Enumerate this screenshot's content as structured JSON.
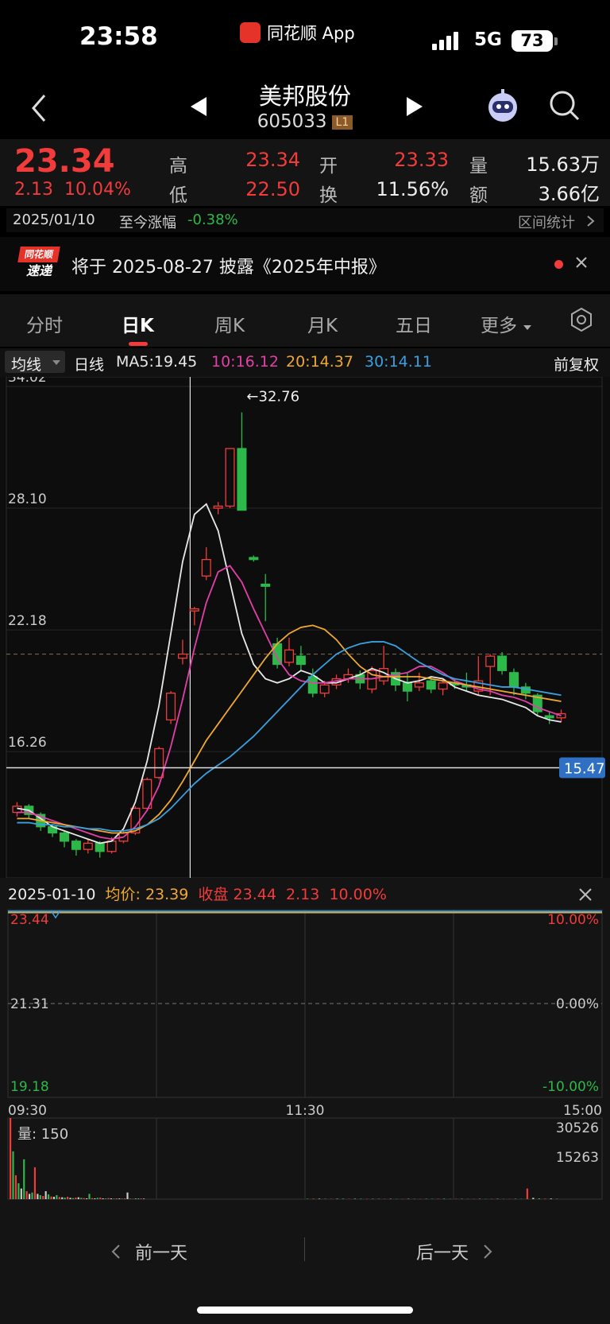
{
  "status_bar": {
    "time": "23:58",
    "app": "同花顺 App",
    "network": "5G",
    "battery": "73"
  },
  "nav": {
    "name": "美邦股份",
    "code": "605033",
    "level": "L1"
  },
  "quote": {
    "price": "23.34",
    "change": "2.13",
    "change_pct": "10.04%",
    "high_label": "高",
    "high": "23.34",
    "low_label": "低",
    "low": "22.50",
    "open_label": "开",
    "open": "23.33",
    "turnover_label": "换",
    "turnover": "11.56%",
    "volume_label": "量",
    "volume": "15.63万",
    "amount_label": "额",
    "amount": "3.66亿"
  },
  "date_band": {
    "date": "2025/01/10",
    "label": "至今涨幅",
    "value": "-0.38%",
    "stats": "区间统计"
  },
  "banner": {
    "logo_top": "同花顺",
    "logo_bottom": "速递",
    "text": "将于 2025-08-27 披露《2025年中报》"
  },
  "tabs": [
    {
      "label": "分时"
    },
    {
      "label": "日K"
    },
    {
      "label": "周K"
    },
    {
      "label": "月K"
    },
    {
      "label": "五日"
    },
    {
      "label": "更多"
    }
  ],
  "ma_band": {
    "selector": "均线",
    "period": "日线",
    "ma5": "MA5:19.45",
    "ma10": "10:16.12",
    "ma20": "20:14.37",
    "ma30": "30:14.11",
    "adjust": "前复权"
  },
  "colors": {
    "up": "#f23b3b",
    "down": "#2db84a",
    "ma5": "#e8e8e8",
    "ma10": "#e33fa8",
    "ma20": "#f0a830",
    "ma30": "#3aa0e0"
  },
  "chart_data": [
    {
      "type": "candlestick",
      "y_ticks": [
        "34.02",
        "28.10",
        "22.18",
        "16.26"
      ],
      "ylim": [
        10.5,
        34.02
      ],
      "max_marker": "←32.76",
      "current_line_label": "15.47",
      "current_line_value": 15.47,
      "dashed_value": 21.0,
      "series": [
        {
          "name": "MA5",
          "values": [
            13.5,
            13.4,
            13.0,
            12.6,
            12.4,
            12.2,
            12.0,
            11.8,
            11.9,
            12.5,
            13.8,
            15.8,
            18.5,
            22.0,
            25.5,
            27.8,
            28.3,
            27.0,
            24.5,
            22.0,
            20.5,
            19.8,
            19.6,
            19.8,
            20.2,
            20.0,
            19.6,
            19.6,
            19.8,
            20.0,
            20.3,
            20.1,
            19.8,
            19.6,
            19.7,
            19.9,
            19.8,
            19.4,
            19.2,
            19.0,
            18.9,
            18.8,
            18.6,
            18.4,
            18.0,
            17.8,
            17.7
          ]
        },
        {
          "name": "MA10",
          "values": [
            13.3,
            13.3,
            13.1,
            12.9,
            12.7,
            12.5,
            12.3,
            12.1,
            12.0,
            12.1,
            12.6,
            13.4,
            14.6,
            16.5,
            18.8,
            21.3,
            23.5,
            25.0,
            25.3,
            24.5,
            23.2,
            22.0,
            20.8,
            20.0,
            19.7,
            19.6,
            19.6,
            19.7,
            19.8,
            19.8,
            19.8,
            19.9,
            20.0,
            20.1,
            20.4,
            20.4,
            20.1,
            19.7,
            19.5,
            19.3,
            19.2,
            19.0,
            18.9,
            18.7,
            18.4,
            18.2,
            18.0
          ]
        },
        {
          "name": "MA20",
          "values": [
            13.0,
            13.0,
            12.9,
            12.8,
            12.7,
            12.6,
            12.5,
            12.4,
            12.3,
            12.3,
            12.4,
            12.7,
            13.2,
            13.9,
            14.8,
            15.8,
            16.8,
            17.6,
            18.4,
            19.2,
            20.0,
            20.8,
            21.5,
            22.0,
            22.3,
            22.4,
            22.2,
            21.7,
            21.0,
            20.4,
            20.0,
            19.9,
            19.9,
            19.9,
            19.9,
            19.8,
            19.7,
            19.6,
            19.5,
            19.4,
            19.3,
            19.2,
            19.1,
            19.0,
            18.9,
            18.8,
            18.7
          ]
        },
        {
          "name": "MA30",
          "values": [
            12.8,
            12.8,
            12.7,
            12.7,
            12.6,
            12.6,
            12.5,
            12.5,
            12.4,
            12.4,
            12.5,
            12.7,
            13.0,
            13.5,
            14.1,
            14.7,
            15.2,
            15.6,
            16.0,
            16.5,
            17.0,
            17.6,
            18.2,
            18.8,
            19.4,
            20.0,
            20.5,
            21.0,
            21.3,
            21.5,
            21.6,
            21.6,
            21.4,
            21.0,
            20.6,
            20.3,
            20.0,
            19.8,
            19.7,
            19.6,
            19.5,
            19.4,
            19.4,
            19.3,
            19.2,
            19.1,
            19.0
          ]
        }
      ],
      "candles": [
        {
          "o": 13.3,
          "c": 13.6,
          "h": 13.8,
          "l": 13.1
        },
        {
          "o": 13.6,
          "c": 13.2,
          "h": 13.7,
          "l": 13.0
        },
        {
          "o": 13.2,
          "c": 12.6,
          "h": 13.3,
          "l": 12.4
        },
        {
          "o": 12.6,
          "c": 12.3,
          "h": 12.7,
          "l": 12.1
        },
        {
          "o": 12.3,
          "c": 11.9,
          "h": 12.4,
          "l": 11.6
        },
        {
          "o": 11.9,
          "c": 11.5,
          "h": 12.0,
          "l": 11.2
        },
        {
          "o": 11.5,
          "c": 11.8,
          "h": 12.0,
          "l": 11.3
        },
        {
          "o": 11.8,
          "c": 11.4,
          "h": 11.9,
          "l": 11.1
        },
        {
          "o": 11.4,
          "c": 11.9,
          "h": 12.1,
          "l": 11.3
        },
        {
          "o": 11.9,
          "c": 12.3,
          "h": 12.4,
          "l": 11.8
        },
        {
          "o": 12.3,
          "c": 13.5,
          "h": 13.6,
          "l": 12.2
        },
        {
          "o": 13.5,
          "c": 14.9,
          "h": 15.0,
          "l": 13.4
        },
        {
          "o": 15.0,
          "c": 16.4,
          "h": 16.5,
          "l": 14.9
        },
        {
          "o": 17.8,
          "c": 19.1,
          "h": 19.2,
          "l": 17.6
        },
        {
          "o": 20.8,
          "c": 21.0,
          "h": 21.7,
          "l": 20.5
        },
        {
          "o": 23.1,
          "c": 23.2,
          "h": 23.3,
          "l": 22.4
        },
        {
          "o": 24.8,
          "c": 25.6,
          "h": 26.2,
          "l": 24.6
        },
        {
          "o": 28.1,
          "c": 28.2,
          "h": 28.4,
          "l": 27.8
        },
        {
          "o": 28.2,
          "c": 31.0,
          "h": 31.0,
          "l": 28.1
        },
        {
          "o": 31.0,
          "c": 28.0,
          "h": 32.76,
          "l": 28.0
        },
        {
          "o": 25.7,
          "c": 25.6,
          "h": 25.8,
          "l": 25.5
        },
        {
          "o": 24.4,
          "c": 24.3,
          "h": 24.9,
          "l": 22.6
        },
        {
          "o": 21.5,
          "c": 20.5,
          "h": 21.8,
          "l": 20.3
        },
        {
          "o": 20.6,
          "c": 21.2,
          "h": 21.8,
          "l": 20.4
        },
        {
          "o": 20.9,
          "c": 20.5,
          "h": 21.4,
          "l": 20.2
        },
        {
          "o": 19.9,
          "c": 19.1,
          "h": 20.3,
          "l": 18.9
        },
        {
          "o": 19.1,
          "c": 19.5,
          "h": 19.7,
          "l": 18.9
        },
        {
          "o": 19.5,
          "c": 19.8,
          "h": 20.0,
          "l": 19.3
        },
        {
          "o": 19.8,
          "c": 20.0,
          "h": 20.3,
          "l": 19.6
        },
        {
          "o": 20.0,
          "c": 19.6,
          "h": 20.2,
          "l": 19.3
        },
        {
          "o": 19.3,
          "c": 20.2,
          "h": 20.4,
          "l": 19.1
        },
        {
          "o": 19.7,
          "c": 20.3,
          "h": 21.4,
          "l": 19.5
        },
        {
          "o": 20.1,
          "c": 19.5,
          "h": 20.3,
          "l": 19.2
        },
        {
          "o": 19.6,
          "c": 19.2,
          "h": 20.1,
          "l": 18.7
        },
        {
          "o": 19.4,
          "c": 19.6,
          "h": 20.1,
          "l": 19.2
        },
        {
          "o": 19.7,
          "c": 19.3,
          "h": 19.9,
          "l": 19.1
        },
        {
          "o": 19.3,
          "c": 19.6,
          "h": 19.8,
          "l": 19.0
        },
        {
          "o": 19.6,
          "c": 19.5,
          "h": 19.8,
          "l": 19.3
        },
        {
          "o": 19.5,
          "c": 19.4,
          "h": 20.1,
          "l": 19.2
        },
        {
          "o": 19.2,
          "c": 19.7,
          "h": 20.9,
          "l": 19.0
        },
        {
          "o": 20.4,
          "c": 20.9,
          "h": 21.0,
          "l": 19.0
        },
        {
          "o": 20.9,
          "c": 20.2,
          "h": 21.1,
          "l": 20.0
        },
        {
          "o": 20.1,
          "c": 19.4,
          "h": 20.3,
          "l": 19.0
        },
        {
          "o": 19.4,
          "c": 19.1,
          "h": 19.6,
          "l": 18.8
        },
        {
          "o": 19.0,
          "c": 18.2,
          "h": 19.1,
          "l": 18.0
        },
        {
          "o": 18.0,
          "c": 17.9,
          "h": 18.2,
          "l": 17.6
        },
        {
          "o": 17.9,
          "c": 18.1,
          "h": 18.3,
          "l": 17.7
        }
      ]
    },
    {
      "type": "line",
      "y_left_ticks": [
        "23.44",
        "21.31",
        "19.18"
      ],
      "y_right_ticks": [
        "10.00%",
        "0.00%",
        "-10.00%"
      ],
      "x_ticks": [
        "09:30",
        "11:30",
        "15:00"
      ],
      "price_value": 23.44,
      "avg_value": 23.39,
      "ylim": [
        19.18,
        23.44
      ]
    },
    {
      "type": "bar",
      "label": "量: 150",
      "y_ticks": [
        "30526",
        "15263"
      ],
      "ylim": [
        0,
        30526
      ],
      "values": [
        30526,
        18000,
        9000,
        6000,
        4000,
        15000,
        3000,
        2000,
        2500,
        12000,
        2000,
        1500,
        1200,
        3000,
        1800,
        1000,
        900,
        1500,
        800,
        700,
        600,
        900,
        500,
        400,
        600,
        700,
        500,
        400,
        300,
        2000,
        400,
        300,
        500,
        600,
        300,
        250,
        400,
        300,
        200,
        300,
        250,
        200,
        300,
        2500,
        200,
        150,
        200,
        300,
        250,
        200,
        150,
        200,
        180,
        150,
        120,
        150,
        200,
        100,
        150,
        180,
        120,
        100,
        150,
        130,
        120,
        110,
        100,
        120,
        130,
        100,
        90,
        100,
        150,
        120,
        100,
        110,
        90,
        100,
        120,
        110,
        100,
        150,
        120,
        100,
        90,
        100,
        110,
        4000,
        500,
        300,
        200,
        250,
        150
      ]
    }
  ],
  "intraday_header": {
    "date": "2025-01-10",
    "avg_label": "均价:",
    "avg": "23.39",
    "close_label": "收盘",
    "close": "23.44",
    "change": "2.13",
    "change_pct": "10.00%"
  },
  "bottom_nav": {
    "prev": "前一天",
    "next": "后一天"
  }
}
